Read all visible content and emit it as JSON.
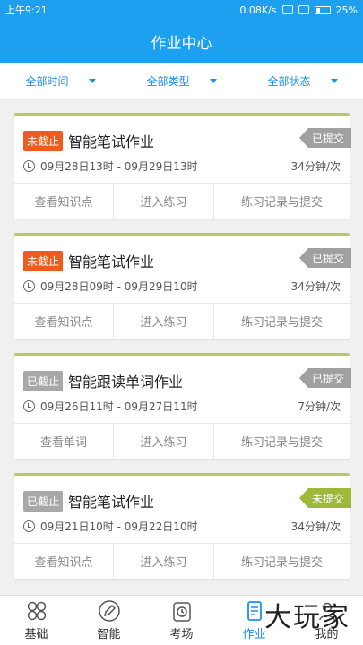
{
  "status_bar": {
    "time": "上午9:21",
    "speed": "0.08K/s",
    "battery": "25%"
  },
  "header": {
    "title": "作业中心"
  },
  "filters": [
    {
      "label": "全部时间"
    },
    {
      "label": "全部类型"
    },
    {
      "label": "全部状态"
    }
  ],
  "colors": {
    "primary": "#1ea0f0",
    "tag_open": "#f05a1e",
    "tag_closed": "#a8a8a8",
    "ribbon_submitted": "#a0a0a0",
    "ribbon_unsubmitted": "#9cb93a",
    "card_border": "#b8cb6a"
  },
  "cards": [
    {
      "tag": "未截止",
      "title": "智能笔试作业",
      "status": "已提交",
      "time_range": "09月28日13时 - 09月29日13时",
      "duration": "34分钟/次",
      "actions": [
        "查看知识点",
        "进入练习",
        "练习记录与提交"
      ]
    },
    {
      "tag": "未截止",
      "title": "智能笔试作业",
      "status": "已提交",
      "time_range": "09月28日09时 - 09月29日10时",
      "duration": "34分钟/次",
      "actions": [
        "查看知识点",
        "进入练习",
        "练习记录与提交"
      ]
    },
    {
      "tag": "已截止",
      "title": "智能跟读单词作业",
      "status": "已提交",
      "time_range": "09月26日11时 - 09月27日11时",
      "duration": "7分钟/次",
      "actions": [
        "查看单词",
        "进入练习",
        "练习记录与提交"
      ]
    },
    {
      "tag": "已截止",
      "title": "智能笔试作业",
      "status": "未提交",
      "time_range": "09月21日10时 - 09月22日10时",
      "duration": "34分钟/次",
      "actions": [
        "查看知识点",
        "进入练习",
        "练习记录与提交"
      ]
    }
  ],
  "tabs": [
    {
      "label": "基础",
      "icon": "four-circles-icon"
    },
    {
      "label": "智能",
      "icon": "pencil-circle-icon"
    },
    {
      "label": "考场",
      "icon": "clock-board-icon"
    },
    {
      "label": "作业",
      "icon": "document-icon"
    },
    {
      "label": "我的",
      "icon": "person-icon"
    }
  ],
  "watermark": "大玩家"
}
